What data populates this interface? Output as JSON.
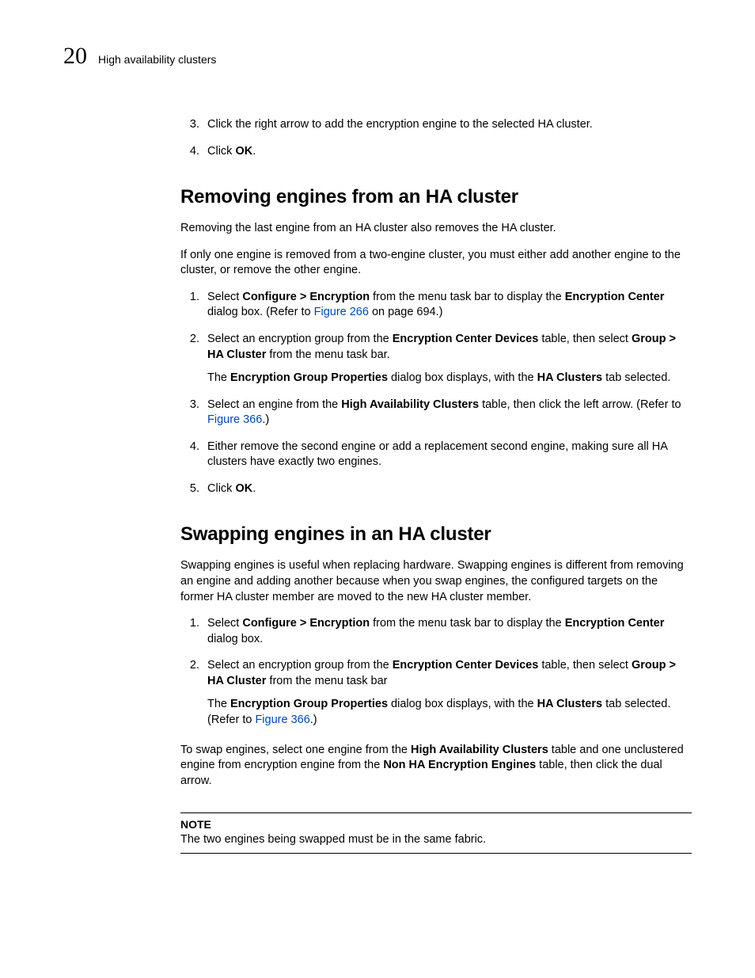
{
  "header": {
    "chapter_number": "20",
    "running_title": "High availability clusters"
  },
  "intro_steps": {
    "start": 3,
    "items": [
      {
        "html": "Click the right arrow to add the encryption engine to the selected HA cluster."
      },
      {
        "html": "Click <span class=\"bold\">OK</span>."
      }
    ]
  },
  "section1": {
    "heading": "Removing engines from an HA cluster",
    "para1": "Removing the last engine from an HA cluster also removes the HA cluster.",
    "para2": "If only one engine is removed from a two-engine cluster, you must either add another engine to the cluster, or remove the other engine.",
    "steps": [
      {
        "html": "Select <span class=\"bold\">Configure &gt; Encryption</span> from the menu task bar to display the <span class=\"bold\">Encryption Center</span> dialog box. (Refer to <a class=\"xref\" href=\"#\" data-name=\"link-figure-266\" data-interactable=\"true\">Figure 266</a> on page 694.)"
      },
      {
        "html": "Select an encryption group from the <span class=\"bold\">Encryption Center Devices</span> table, then select <span class=\"bold\">Group &gt; HA Cluster</span> from the menu task bar.",
        "sub_html": "The <span class=\"bold\">Encryption Group Properties</span> dialog box displays, with the <span class=\"bold\">HA Clusters</span> tab selected."
      },
      {
        "html": "Select an engine from the <span class=\"bold\">High Availability Clusters</span> table, then click the left arrow. (Refer to <a class=\"xref\" href=\"#\" data-name=\"link-figure-366-a\" data-interactable=\"true\">Figure 366</a>.)"
      },
      {
        "html": "Either remove the second engine or add a replacement second engine, making sure all HA clusters have exactly two engines."
      },
      {
        "html": "Click <span class=\"bold\">OK</span>."
      }
    ]
  },
  "section2": {
    "heading": "Swapping engines in an HA cluster",
    "para1": "Swapping engines is useful when replacing hardware. Swapping engines is different from removing an engine and adding another because when you swap engines, the configured targets on the former HA cluster member are moved to the new HA cluster member.",
    "steps": [
      {
        "html": "Select <span class=\"bold\">Configure &gt; Encryption</span> from the menu task bar to display the <span class=\"bold\">Encryption Center</span> dialog box."
      },
      {
        "html": "Select an encryption group from the <span class=\"bold\">Encryption Center Devices</span> table, then select <span class=\"bold\">Group &gt; HA Cluster</span> from the menu task bar",
        "sub_html": "The <span class=\"bold\">Encryption Group Properties</span> dialog box displays, with the <span class=\"bold\">HA Clusters</span> tab selected. (Refer to <a class=\"xref\" href=\"#\" data-name=\"link-figure-366-b\" data-interactable=\"true\">Figure 366</a>.)"
      }
    ],
    "para2_html": "To swap engines, select one engine from the <span class=\"bold\">High Availability Clusters</span> table and one unclustered engine from encryption engine from the <span class=\"bold\">Non HA Encryption Engines</span> table, then click the dual arrow.",
    "note_label": "NOTE",
    "note_text": "The two engines being swapped must be in the same fabric."
  }
}
